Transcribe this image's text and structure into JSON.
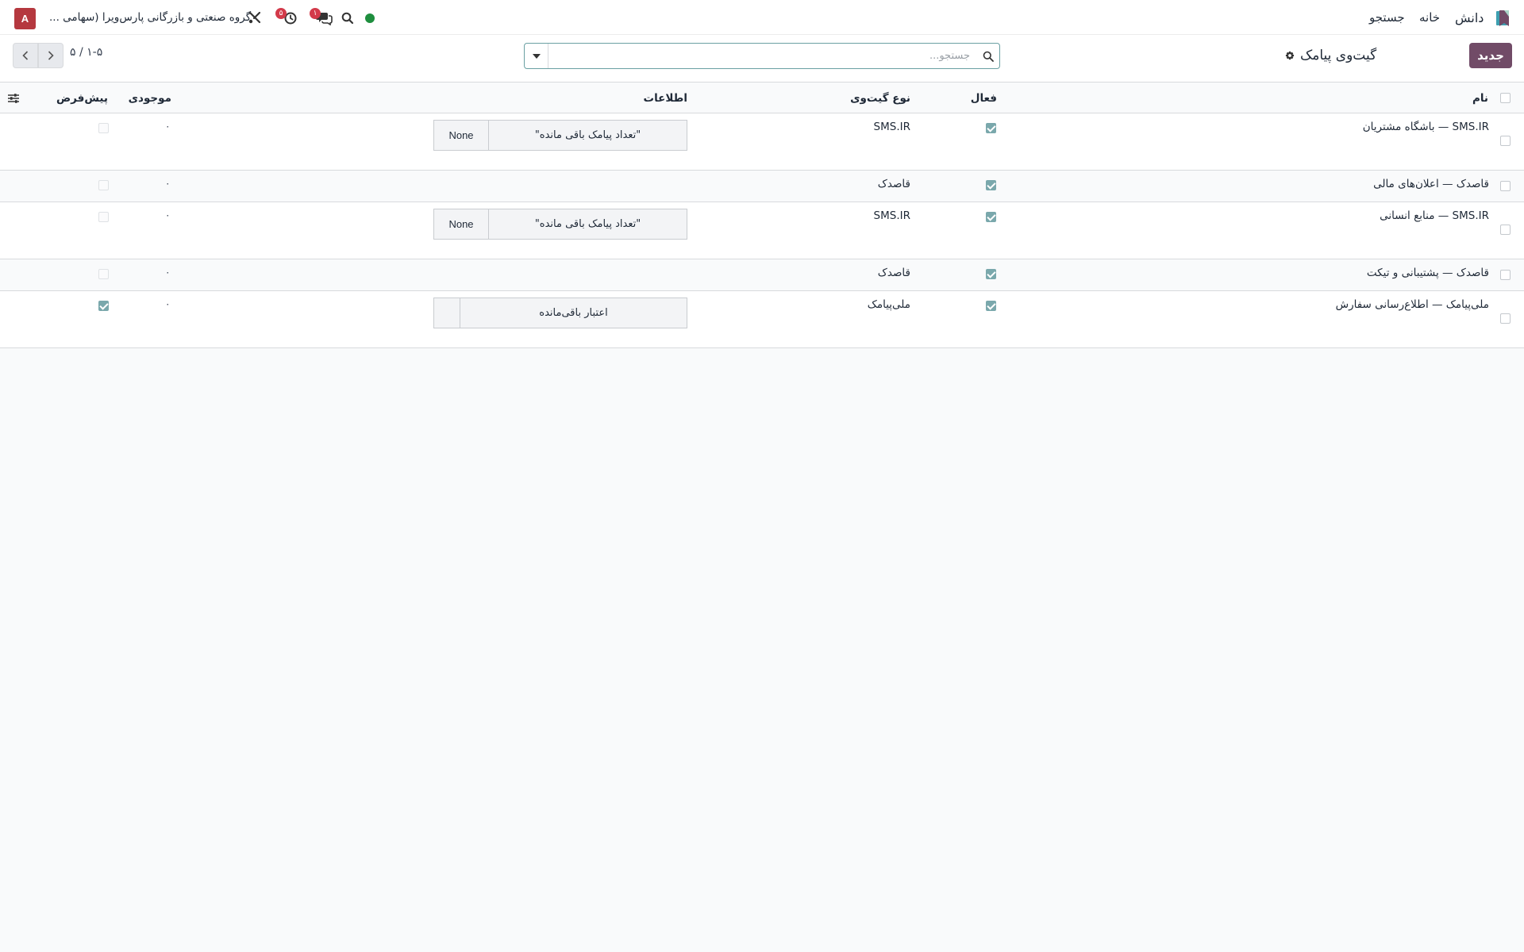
{
  "navbar": {
    "menu": [
      "دانش",
      "خانه",
      "جستجو"
    ],
    "company": "گروه صنعتی و بازرگانی پارس‌ویرا (سهامی ...",
    "avatar_letter": "A",
    "activity_badge": "۵",
    "messages_badge": "۱",
    "presence_color": "#1e8e3e"
  },
  "control_panel": {
    "new_button": "جدید",
    "title": "گیت‌وی پیامک",
    "search_placeholder": "جستجو...",
    "pager": "۱-۵ / ۵"
  },
  "list": {
    "columns": {
      "name": "نام",
      "active": "فعال",
      "gateway_type": "نوع گیت‌وی",
      "info": "اطلاعات",
      "balance": "موجودی",
      "default": "پیش‌فرض"
    },
    "rows": [
      {
        "name": "SMS.IR — باشگاه مشتریان",
        "active": true,
        "gateway_type": "SMS.IR",
        "info_label": "\"تعداد پیامک باقی مانده\"",
        "info_value": "None",
        "balance": "۰",
        "is_default": false
      },
      {
        "name": "قاصدک — اعلان‌های مالی",
        "active": true,
        "gateway_type": "قاصدک",
        "info_label": "",
        "info_value": "",
        "balance": "۰",
        "is_default": false
      },
      {
        "name": "SMS.IR — منابع انسانی",
        "active": true,
        "gateway_type": "SMS.IR",
        "info_label": "\"تعداد پیامک باقی مانده\"",
        "info_value": "None",
        "balance": "۰",
        "is_default": false
      },
      {
        "name": "قاصدک — پشتیبانی و تیکت",
        "active": true,
        "gateway_type": "قاصدک",
        "info_label": "",
        "info_value": "",
        "balance": "۰",
        "is_default": false
      },
      {
        "name": "ملی‌پیامک — اطلاع‌رسانی سفارش",
        "active": true,
        "gateway_type": "ملی‌پیامک",
        "info_label": "اعتبار باقی‌مانده",
        "info_value": "",
        "balance": "۰",
        "is_default": true
      }
    ]
  },
  "colors": {
    "primary": "#714b67",
    "accent_checkbox": "#7aa8ac",
    "badge": "#d33a4a",
    "avatar": "#b5383f"
  }
}
